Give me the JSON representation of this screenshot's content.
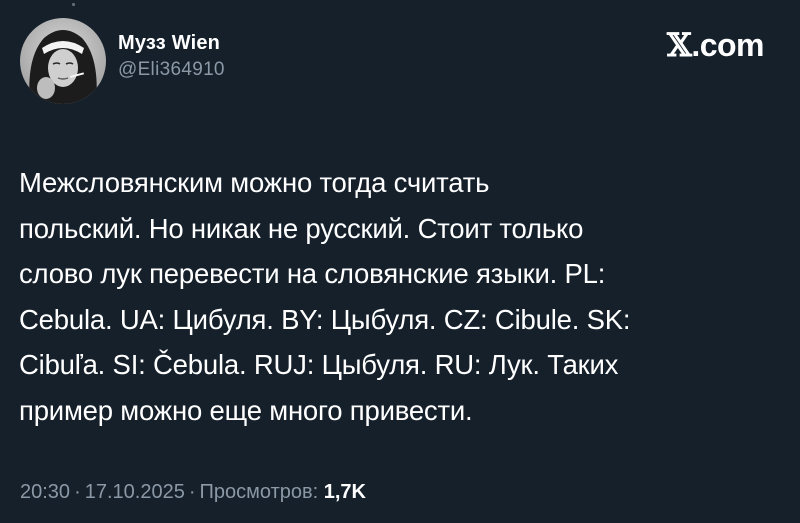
{
  "brand": {
    "logo_text": ".com",
    "logo_icon": "x-logo-icon"
  },
  "author": {
    "display_name": "Музз Wien",
    "handle": "@Eli364910",
    "avatar_icon": "avatar-photo"
  },
  "tweet": {
    "lines": [
      "Межсловянским можно тогда считать",
      "польский. Но никак не русский. Стоит только",
      "слово лук перевести на словянские языки. PL:",
      "Cebula. UA: Цибуля. BY: Цыбуля. CZ: Cibule. SK:",
      "Cibuľa. SI: Čebula. RUJ: Цыбуля. RU: Лук. Таких",
      "пример можно еще много привести."
    ]
  },
  "meta": {
    "time": "20:30",
    "separator": "·",
    "date": "17.10.2025",
    "views_label": "Просмотров:",
    "views_count": "1,7K"
  },
  "colors": {
    "background": "#15202b",
    "text_primary": "#ffffff",
    "text_secondary": "#8b98a5"
  }
}
